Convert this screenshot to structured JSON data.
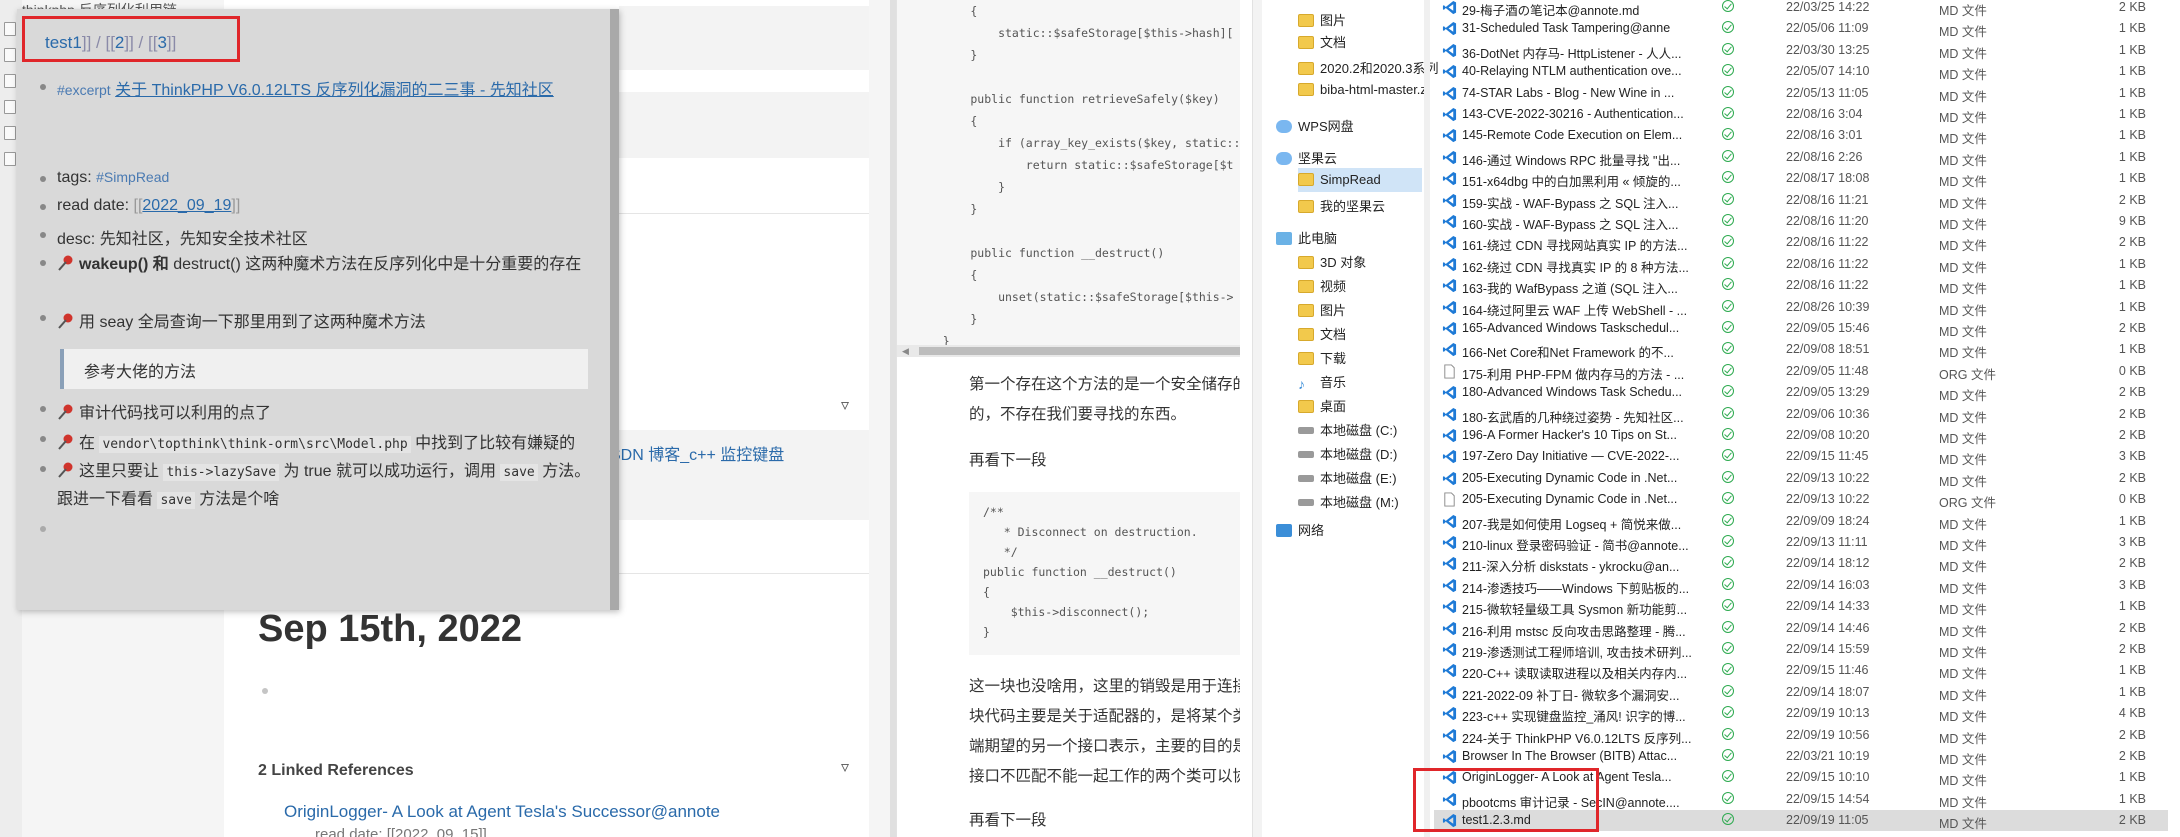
{
  "left_app": {
    "top_text": "thinkphp 反序列化利用链...",
    "bg_link": "SDN 博客_c++ 监控键盘",
    "journal_date": "Sep 15th, 2022",
    "linked_refs": "2 Linked References",
    "ref_item": "OriginLogger- A Look at Agent Tesla's Successor@annote",
    "ref_readdate": "read date: [[2022_09_15]]",
    "popup": {
      "crumb1": "test1",
      "crumb_sep1": "]] / [[",
      "crumb2": "2",
      "crumb_sep2": "]] / [[",
      "crumb3": "3",
      "crumb_end": "]]",
      "excerpt_tag": "#excerpt",
      "excerpt_link": "关于 ThinkPHP V6.0.12LTS 反序列化漏洞的二三事 - 先知社区",
      "tags_label": "tags:",
      "tags_value": "#SimpRead",
      "readdate_label": "read date:",
      "readdate_open": "[[",
      "readdate_value": "2022_09_19",
      "readdate_close": "]]",
      "desc": "desc: 先知社区，先知安全技术社区",
      "wakeup_bold": "wakeup() 和",
      "wakeup_rest": " destruct() 这两种魔术方法在反序列化中是十分重要的存在",
      "seay": "用 seay 全局查询一下那里用到了这两种魔术方法",
      "quote": "参考大佬的方法",
      "audit": "审计代码找可以利用的点了",
      "in_prefix": "在",
      "in_code": "vendor\\topthink\\think-orm\\src\\Model.php",
      "in_suffix": "中找到了比较有嫌疑的",
      "lazy_prefix": "这里只要让",
      "lazy_code": "this->lazySave",
      "lazy_mid": "为 true 就可以成功运行，调用",
      "lazy_code2": "save",
      "lazy_suffix": "方法。",
      "follow_prefix": "跟进一下看看",
      "follow_code": "save",
      "follow_suffix": "方法是个啥"
    }
  },
  "middle": {
    "code1": "        {\n            static::$safeStorage[$this->hash][\n        }\n\n        public function retrieveSafely($key)\n        {\n            if (array_key_exists($key, static::\n                return static::$safeStorage[$t\n            }\n        }\n\n        public function __destruct()\n        {\n            unset(static::$safeStorage[$this->\n        }\n    }",
    "p1_line1": "第一个存在这个方法的是一个安全储存的",
    "p1_line2": "的，不存在我们要寻找的东西。",
    "p2": "再看下一段",
    "code2": "/**\n   * Disconnect on destruction.\n   */\npublic function __destruct()\n{\n    $this->disconnect();\n}",
    "p3_line1": "这一块也没啥用，这里的销毁是用于连接",
    "p3_line2": "块代码主要是关于适配器的，是将某个类",
    "p3_line3": "端期望的另一个接口表示，主要的目的是",
    "p3_line4": "接口不匹配不能一起工作的两个类可以协",
    "p4": "再看下一段"
  },
  "explorer": {
    "nav": [
      {
        "label": "图片",
        "icon": "folder-icon"
      },
      {
        "label": "文档",
        "icon": "folder-icon"
      },
      {
        "label": "2020.2和2020.3系列",
        "icon": "folder-icon"
      },
      {
        "label": "biba-html-master.z",
        "icon": "folder-icon"
      },
      {
        "label": "WPS网盘",
        "icon": "cloud-icon"
      },
      {
        "label": "坚果云",
        "icon": "cloud-icon"
      },
      {
        "label": "SimpRead",
        "icon": "folder-icon"
      },
      {
        "label": "我的坚果云",
        "icon": "folder-icon"
      },
      {
        "label": "此电脑",
        "icon": "pc-icon"
      },
      {
        "label": "3D 对象",
        "icon": "folder-icon"
      },
      {
        "label": "视频",
        "icon": "folder-icon"
      },
      {
        "label": "图片",
        "icon": "folder-icon"
      },
      {
        "label": "文档",
        "icon": "folder-icon"
      },
      {
        "label": "下载",
        "icon": "folder-icon"
      },
      {
        "label": "音乐",
        "icon": "music-icon"
      },
      {
        "label": "桌面",
        "icon": "folder-icon"
      },
      {
        "label": "本地磁盘 (C:)",
        "icon": "drive-icon"
      },
      {
        "label": "本地磁盘 (D:)",
        "icon": "drive-icon"
      },
      {
        "label": "本地磁盘 (E:)",
        "icon": "drive-icon"
      },
      {
        "label": "本地磁盘 (M:)",
        "icon": "drive-icon"
      },
      {
        "label": "网络",
        "icon": "network-icon"
      }
    ],
    "files": [
      {
        "name": "29-梅子酒の笔记本@annote.md",
        "date": "22/03/25 14:22",
        "type": "MD 文件",
        "size": "2 KB",
        "icon": "vscode"
      },
      {
        "name": "31-Scheduled Task Tampering@anne",
        "date": "22/05/06 11:09",
        "type": "MD 文件",
        "size": "1 KB",
        "icon": "vscode"
      },
      {
        "name": "36-DotNet 内存马- HttpListener - 人人...",
        "date": "22/03/30 13:25",
        "type": "MD 文件",
        "size": "1 KB",
        "icon": "vscode"
      },
      {
        "name": "40-Relaying NTLM authentication ove...",
        "date": "22/05/07 14:10",
        "type": "MD 文件",
        "size": "1 KB",
        "icon": "vscode"
      },
      {
        "name": "74-STAR Labs - Blog - New Wine in ...",
        "date": "22/05/13 11:05",
        "type": "MD 文件",
        "size": "1 KB",
        "icon": "vscode"
      },
      {
        "name": "143-CVE-2022-30216 - Authentication...",
        "date": "22/08/16 3:04",
        "type": "MD 文件",
        "size": "1 KB",
        "icon": "vscode"
      },
      {
        "name": "145-Remote Code Execution on Elem...",
        "date": "22/08/16 3:01",
        "type": "MD 文件",
        "size": "1 KB",
        "icon": "vscode"
      },
      {
        "name": "146-通过 Windows RPC 批量寻找 \"出...",
        "date": "22/08/16 2:26",
        "type": "MD 文件",
        "size": "1 KB",
        "icon": "vscode"
      },
      {
        "name": "151-x64dbg 中的白加黑利用 « 倾旋的...",
        "date": "22/08/17 18:08",
        "type": "MD 文件",
        "size": "1 KB",
        "icon": "vscode"
      },
      {
        "name": "159-实战 - WAF-Bypass 之 SQL 注入...",
        "date": "22/08/16 11:21",
        "type": "MD 文件",
        "size": "2 KB",
        "icon": "vscode"
      },
      {
        "name": "160-实战 - WAF-Bypass 之 SQL 注入...",
        "date": "22/08/16 11:20",
        "type": "MD 文件",
        "size": "9 KB",
        "icon": "vscode"
      },
      {
        "name": "161-绕过 CDN 寻找网站真实 IP 的方法...",
        "date": "22/08/16 11:22",
        "type": "MD 文件",
        "size": "2 KB",
        "icon": "vscode"
      },
      {
        "name": "162-绕过 CDN 寻找真实 IP 的 8 种方法...",
        "date": "22/08/16 11:22",
        "type": "MD 文件",
        "size": "1 KB",
        "icon": "vscode"
      },
      {
        "name": "163-我的 WafBypass 之道 (SQL 注入...",
        "date": "22/08/16 11:22",
        "type": "MD 文件",
        "size": "1 KB",
        "icon": "vscode"
      },
      {
        "name": "164-绕过阿里云 WAF 上传 WebShell - ...",
        "date": "22/08/26 10:39",
        "type": "MD 文件",
        "size": "1 KB",
        "icon": "vscode"
      },
      {
        "name": "165-Advanced Windows Taskschedul...",
        "date": "22/09/05 15:46",
        "type": "MD 文件",
        "size": "2 KB",
        "icon": "vscode"
      },
      {
        "name": "166-Net Core和Net Framework 的不...",
        "date": "22/09/08 18:51",
        "type": "MD 文件",
        "size": "1 KB",
        "icon": "vscode"
      },
      {
        "name": "175-利用 PHP-FPM 做内存马的方法 - ...",
        "date": "22/09/05 11:48",
        "type": "ORG 文件",
        "size": "0 KB",
        "icon": "doc"
      },
      {
        "name": "180-Advanced Windows Task Schedu...",
        "date": "22/09/05 13:29",
        "type": "MD 文件",
        "size": "2 KB",
        "icon": "vscode"
      },
      {
        "name": "180-玄武盾的几种绕过姿势 - 先知社区...",
        "date": "22/09/06 10:36",
        "type": "MD 文件",
        "size": "2 KB",
        "icon": "vscode"
      },
      {
        "name": "196-A Former Hacker's 10 Tips on St...",
        "date": "22/09/08 10:20",
        "type": "MD 文件",
        "size": "2 KB",
        "icon": "vscode"
      },
      {
        "name": "197-Zero Day Initiative — CVE-2022-...",
        "date": "22/09/15 11:45",
        "type": "MD 文件",
        "size": "3 KB",
        "icon": "vscode"
      },
      {
        "name": "205-Executing Dynamic Code in .Net...",
        "date": "22/09/13 10:22",
        "type": "MD 文件",
        "size": "2 KB",
        "icon": "vscode"
      },
      {
        "name": "205-Executing Dynamic Code in .Net...",
        "date": "22/09/13 10:22",
        "type": "ORG 文件",
        "size": "0 KB",
        "icon": "doc"
      },
      {
        "name": "207-我是如何使用 Logseq + 简悦来做...",
        "date": "22/09/09 18:24",
        "type": "MD 文件",
        "size": "1 KB",
        "icon": "vscode"
      },
      {
        "name": "210-linux 登录密码验证 - 简书@annote...",
        "date": "22/09/13 11:11",
        "type": "MD 文件",
        "size": "3 KB",
        "icon": "vscode"
      },
      {
        "name": "211-深入分析 diskstats - ykrocku@an...",
        "date": "22/09/14 18:12",
        "type": "MD 文件",
        "size": "2 KB",
        "icon": "vscode"
      },
      {
        "name": "214-渗透技巧——Windows 下剪贴板的...",
        "date": "22/09/14 16:03",
        "type": "MD 文件",
        "size": "3 KB",
        "icon": "vscode"
      },
      {
        "name": "215-微软轻量级工具 Sysmon 新功能剪...",
        "date": "22/09/14 14:33",
        "type": "MD 文件",
        "size": "1 KB",
        "icon": "vscode"
      },
      {
        "name": "216-利用 mstsc 反向攻击思路整理 - 腾...",
        "date": "22/09/14 14:46",
        "type": "MD 文件",
        "size": "2 KB",
        "icon": "vscode"
      },
      {
        "name": "219-渗透测试工程师培训, 攻击技术研判...",
        "date": "22/09/14 15:59",
        "type": "MD 文件",
        "size": "2 KB",
        "icon": "vscode"
      },
      {
        "name": "220-C++ 读取读取进程以及相关内存内...",
        "date": "22/09/15 11:46",
        "type": "MD 文件",
        "size": "1 KB",
        "icon": "vscode"
      },
      {
        "name": "221-2022-09 补丁日- 微软多个漏洞安...",
        "date": "22/09/14 18:07",
        "type": "MD 文件",
        "size": "1 KB",
        "icon": "vscode"
      },
      {
        "name": "223-c++ 实现键盘监控_涌风! 识字的博...",
        "date": "22/09/19 10:13",
        "type": "MD 文件",
        "size": "4 KB",
        "icon": "vscode"
      },
      {
        "name": "224-关于 ThinkPHP V6.0.12LTS 反序列...",
        "date": "22/09/19 10:56",
        "type": "MD 文件",
        "size": "2 KB",
        "icon": "vscode"
      },
      {
        "name": "Browser In The Browser (BITB) Attac...",
        "date": "22/03/21 10:19",
        "type": "MD 文件",
        "size": "2 KB",
        "icon": "vscode"
      },
      {
        "name": "OriginLogger- A Look at Agent Tesla...",
        "date": "22/09/15 10:10",
        "type": "MD 文件",
        "size": "1 KB",
        "icon": "vscode"
      },
      {
        "name": "pbootcms 审计记录 - SecIN@annote....",
        "date": "22/09/15 14:54",
        "type": "MD 文件",
        "size": "1 KB",
        "icon": "vscode"
      },
      {
        "name": "test1.2.3.md",
        "date": "22/09/19 11:05",
        "type": "MD 文件",
        "size": "2 KB",
        "icon": "vscode",
        "selected": true
      }
    ]
  },
  "colors": {
    "link": "#2a6aaa",
    "highlight_box": "#e0262a",
    "vscode_blue": "#1e7ad6",
    "sync_green": "#2eaa50"
  }
}
